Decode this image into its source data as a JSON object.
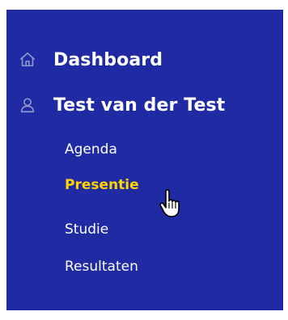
{
  "sidebar": {
    "items": [
      {
        "label": "Dashboard",
        "icon": "home-icon"
      },
      {
        "label": "Test van der Test",
        "icon": "user-icon"
      }
    ],
    "subitems": [
      {
        "label": "Agenda"
      },
      {
        "label": "Presentie",
        "active": true
      },
      {
        "label": "Studie"
      },
      {
        "label": "Resultaten"
      }
    ]
  },
  "colors": {
    "sidebar_bg": "#1f2aa3",
    "text": "#ffffff",
    "active": "#ffd400",
    "icon": "#8f94c9"
  },
  "cursor": {
    "icon": "hand-pointer-icon"
  }
}
